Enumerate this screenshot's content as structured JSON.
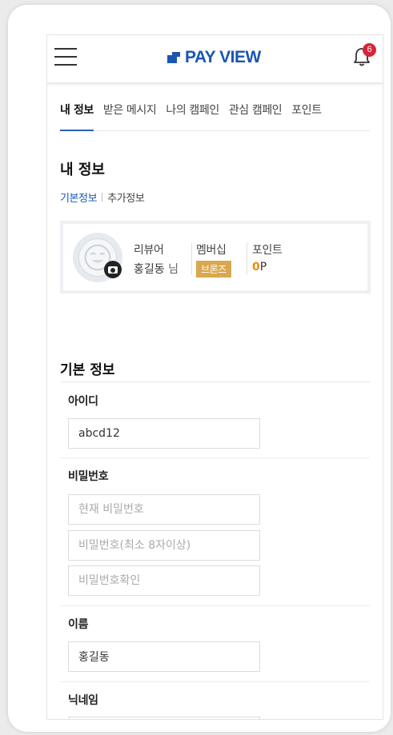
{
  "header": {
    "logo_text": "PAY VIEW",
    "notification_count": "6",
    "brand_color": "#1a56b0",
    "badge_color": "#d9233a"
  },
  "tabs": [
    {
      "label": "내 정보",
      "active": true
    },
    {
      "label": "받은 메시지",
      "active": false
    },
    {
      "label": "나의 캠페인",
      "active": false
    },
    {
      "label": "관심 캠페인",
      "active": false
    },
    {
      "label": "포인트",
      "active": false
    }
  ],
  "page": {
    "title": "내 정보",
    "subtabs": [
      {
        "label": "기본정보",
        "active": true
      },
      {
        "label": "추가정보",
        "active": false
      }
    ]
  },
  "profile": {
    "role_label": "리뷰어",
    "name": "홍길동",
    "name_suffix": "님",
    "membership_label": "멤버십",
    "grade": "브론즈",
    "points_label": "포인트",
    "points_value": "0",
    "points_unit": "P",
    "grade_color": "#d9a84e",
    "points_color": "#f08a00"
  },
  "form": {
    "section_title": "기본 정보",
    "id_label": "아이디",
    "id_value": "abcd12",
    "password_label": "비밀번호",
    "current_password_placeholder": "현재 비밀번호",
    "new_password_placeholder": "비밀번호(최소 8자이상)",
    "confirm_password_placeholder": "비밀번호확인",
    "name_label": "이름",
    "name_value": "홍길동",
    "nickname_label": "닉네임"
  }
}
